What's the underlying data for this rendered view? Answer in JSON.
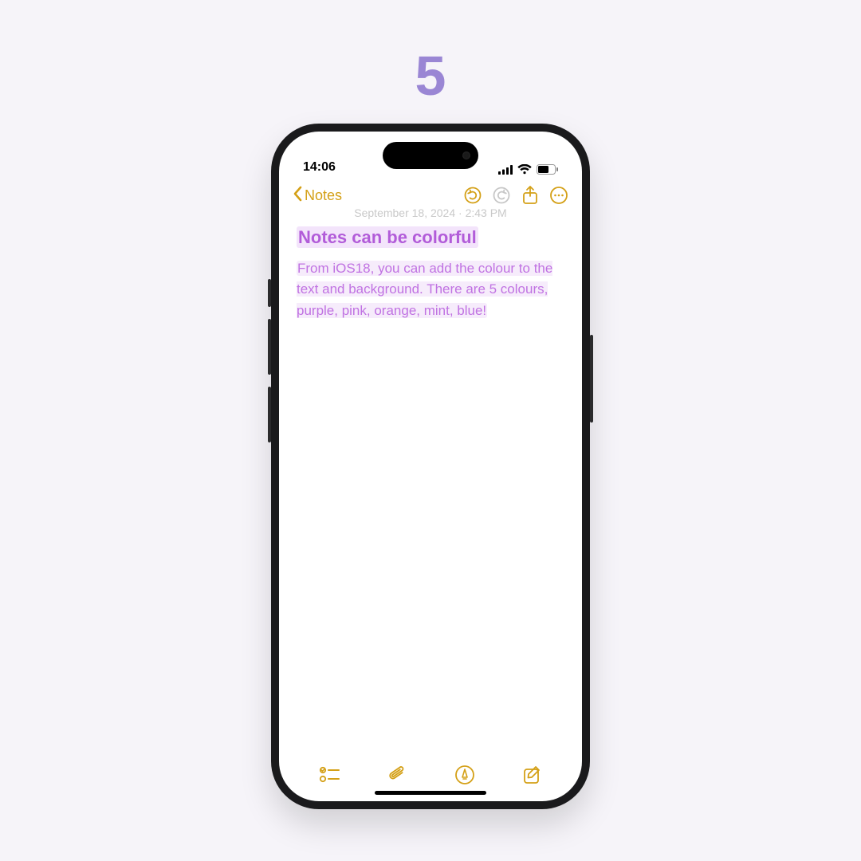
{
  "page": {
    "number": "5"
  },
  "status": {
    "time": "14:06"
  },
  "nav": {
    "back_label": "Notes",
    "timestamp": "September 18, 2024 · 2:43 PM"
  },
  "note": {
    "title": "Notes can be colorful",
    "body": "From iOS18, you can add the colour to the text and background. There are 5 colours, purple, pink, orange, mint, blue!"
  },
  "colors": {
    "accent": "#d4a017",
    "text_purple": "#b25cd9",
    "highlight_purple": "#f3e4fb"
  }
}
